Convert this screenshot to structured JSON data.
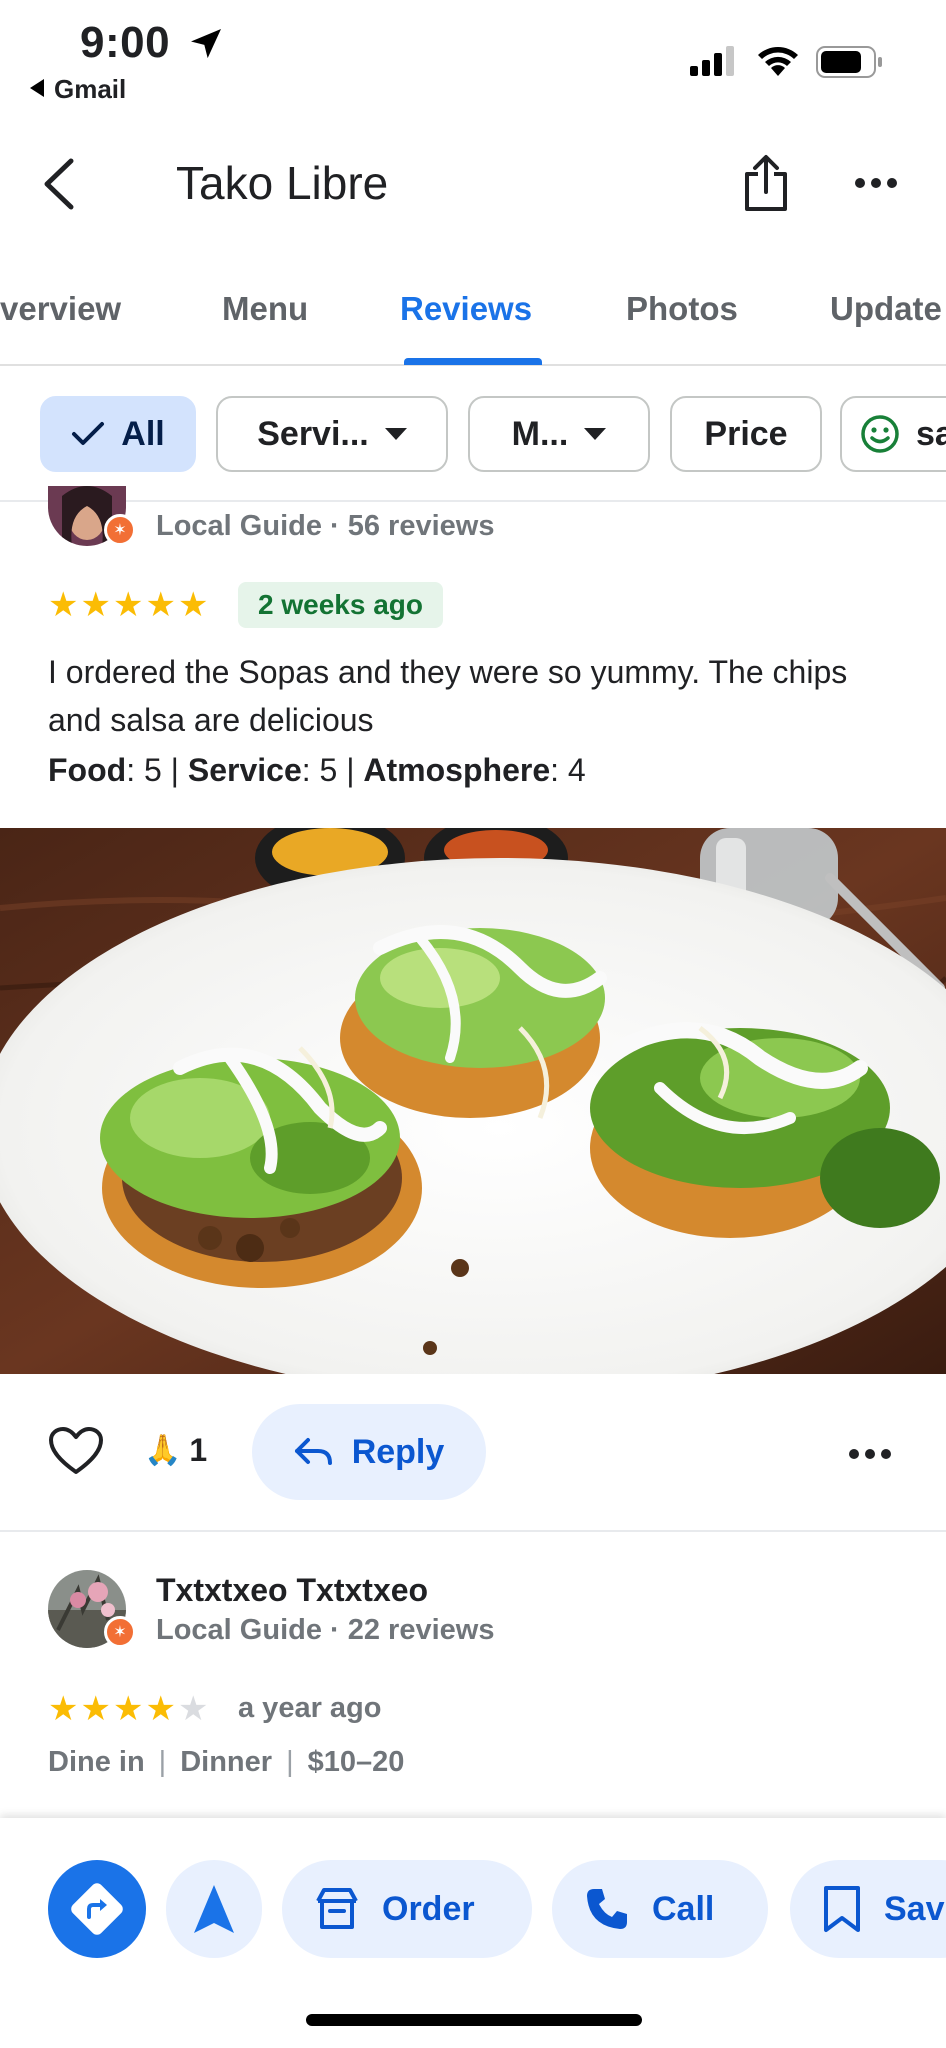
{
  "status_bar": {
    "time": "9:00",
    "back_app": "Gmail"
  },
  "header": {
    "title": "Tako Libre"
  },
  "tabs": [
    {
      "label": "verview"
    },
    {
      "label": "Menu"
    },
    {
      "label": "Reviews"
    },
    {
      "label": "Photos"
    },
    {
      "label": "Update"
    }
  ],
  "filters": [
    {
      "label": "All"
    },
    {
      "label": "Servi..."
    },
    {
      "label": "M..."
    },
    {
      "label": "Price"
    },
    {
      "label": "sa"
    }
  ],
  "review1": {
    "meta": "Local Guide · 56 reviews",
    "rating": 5,
    "time": "2 weeks ago",
    "text": "I ordered the Sopas and they were so yummy. The chips and salsa are delicious",
    "food_label": "Food",
    "food_value": ": 5 | ",
    "service_label": "Service",
    "service_value": ": 5 | ",
    "atmosphere_label": "Atmosphere",
    "atmosphere_value": ": 4",
    "reaction_count": "1",
    "reply_label": "Reply"
  },
  "review2": {
    "name": "Txtxtxeo Txtxtxeo",
    "meta": "Local Guide · 22 reviews",
    "rating": 4,
    "time": "a year ago",
    "tags": [
      "Dine in",
      "Dinner",
      "$10–20"
    ]
  },
  "bottom_bar": {
    "order_label": "Order",
    "call_label": "Call",
    "save_label": "Sav"
  },
  "colors": {
    "accent": "#1a73e8",
    "star": "#fbbc04",
    "time_badge_bg": "#e6f4ea",
    "time_badge_fg": "#137333"
  }
}
